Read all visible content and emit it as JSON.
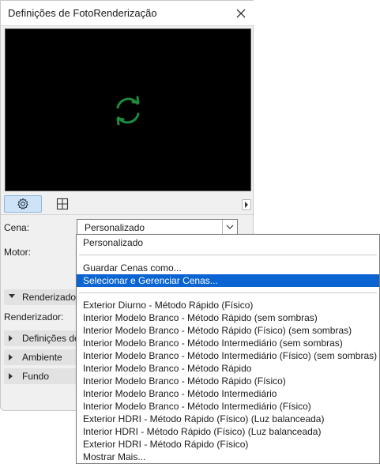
{
  "window": {
    "title": "Definições de FotoRenderização"
  },
  "icons": {
    "close": "close-icon",
    "refresh": "refresh-icon",
    "settings": "gear-icon",
    "grid": "grid-icon",
    "scroll_right": "chevron-right-icon",
    "combo_arrow": "chevron-down-icon",
    "section_expanded": "triangle-down-icon",
    "section_collapsed": "triangle-right-icon"
  },
  "colors": {
    "preview_bg": "#000000",
    "spinner": "#1f8a3c",
    "selection": "#0a64d2",
    "active_tab": "#cfe3f7"
  },
  "form": {
    "scene_label": "Cena:",
    "scene_value": "Personalizado",
    "engine_label": "Motor:",
    "renderer_label": "Renderizador:"
  },
  "sections": {
    "renderer": "Renderizador",
    "definitions": "Definições de",
    "environment": "Ambiente",
    "background": "Fundo"
  },
  "dropdown": {
    "current": "Personalizado",
    "save_scenes": "Guardar Cenas como...",
    "manage_scenes": "Selecionar e Gerenciar Cenas...",
    "presets": [
      "Exterior Diurno - Método Rápido (Físico)",
      "Interior Modelo Branco - Método Rápido (sem sombras)",
      "Interior Modelo Branco - Método Rápido (Físico) (sem sombras)",
      "Interior Modelo Branco - Método Intermediário (sem sombras)",
      "Interior Modelo Branco - Método Intermediário (Físico) (sem sombras)",
      "Interior Modelo Branco - Método Rápido",
      "Interior Modelo Branco - Método Rápido (Físico)",
      "Interior Modelo Branco - Método Intermediário",
      "Interior Modelo Branco - Método Intermediário (Físico)",
      "Exterior HDRI - Método Rápido (Físico) (Luz balanceada)",
      "Interior HDRI - Método Rápido (Físico) (Luz balanceada)",
      "Exterior HDRI - Método Rápido (Físico)"
    ],
    "show_more": "Mostrar Mais..."
  }
}
